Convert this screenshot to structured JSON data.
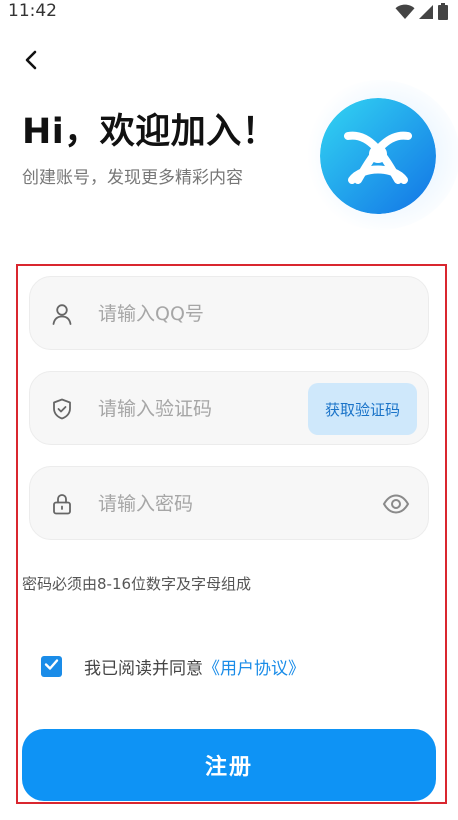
{
  "status_bar": {
    "time": "11:42",
    "icons": [
      "wifi-icon",
      "signal-icon",
      "battery-icon"
    ]
  },
  "header": {
    "back_icon": "chevron-left-icon",
    "title": "Hi，欢迎加入！",
    "subtitle": "创建账号，发现更多精彩内容",
    "logo_icon": "app-logo-icon"
  },
  "form": {
    "qq_field": {
      "placeholder": "请输入QQ号",
      "value": "",
      "icon": "user-icon"
    },
    "code_field": {
      "placeholder": "请输入验证码",
      "value": "",
      "icon": "shield-check-icon",
      "button_label": "获取验证码"
    },
    "password_field": {
      "placeholder": "请输入密码",
      "value": "",
      "icon": "lock-icon",
      "toggle_icon": "eye-icon"
    },
    "password_hint": "密码必须由8-16位数字及字母组成",
    "agreement": {
      "checked": true,
      "text": "我已阅读并同意",
      "link_text": "《用户协议》"
    },
    "submit_label": "注册"
  },
  "colors": {
    "accent": "#0E93F5",
    "link": "#1A8CE8",
    "code_button_bg": "#CFE8FB",
    "highlight_frame": "#D9262F"
  }
}
